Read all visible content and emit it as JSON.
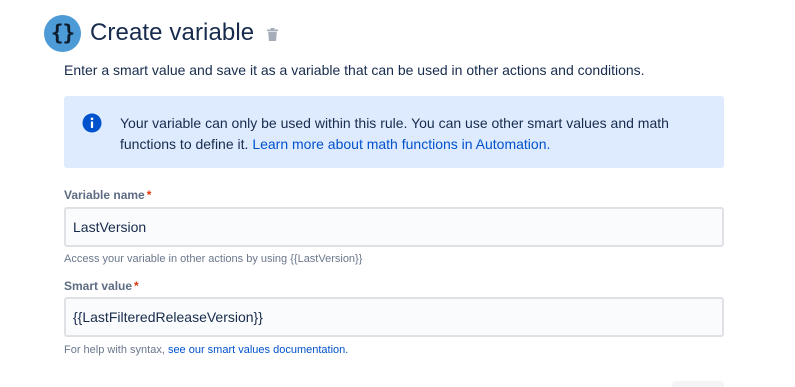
{
  "header": {
    "icon": "braces-icon",
    "icon_glyph": "{}",
    "title": "Create variable",
    "delete_icon": "trash-icon"
  },
  "description": "Enter a smart value and save it as a variable that can be used in other actions and conditions.",
  "info_panel": {
    "icon": "info-icon",
    "text": "Your variable can only be used within this rule. You can use other smart values and math functions to define it.",
    "link_text": "Learn more about math functions in Automation."
  },
  "variable_name": {
    "label": "Variable name",
    "required_mark": "*",
    "value": "LastVersion",
    "helper": "Access your variable in other actions by using {{LastVersion}}"
  },
  "smart_value": {
    "label": "Smart value",
    "required_mark": "*",
    "value": "{{LastFilteredReleaseVersion}}",
    "helper_prefix": "For help with syntax,",
    "helper_link": "see our smart values documentation."
  },
  "colors": {
    "accent": "#4c9ad6",
    "info_background": "#deebff",
    "info_icon": "#0052cc",
    "link": "#0052cc",
    "required": "#de350b"
  }
}
